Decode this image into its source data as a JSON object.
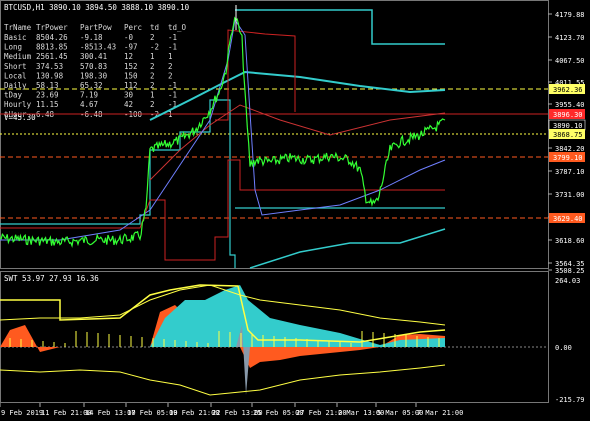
{
  "symbol_line": "BTCUSD,H1  3890.10 3894.50 3888.10 3890.10",
  "stats_table": {
    "headers": [
      "TrName",
      "TrPower",
      "PartPow",
      "Perc",
      "td",
      "td_O"
    ],
    "rows": [
      [
        "Basic",
        "8504.26",
        "-9.18",
        "-0",
        "2",
        "-1"
      ],
      [
        "Long",
        "8813.85",
        "-8513.43",
        "-97",
        "-2",
        "-1"
      ],
      [
        "Medium",
        "2561.45",
        "300.41",
        "12",
        "1",
        "1"
      ],
      [
        "Short",
        "374.53",
        "570.83",
        "152",
        "2",
        "2"
      ],
      [
        "Local",
        "130.98",
        "198.30",
        "150",
        "2",
        "2"
      ],
      [
        "Daily",
        "58.13",
        "65.32",
        "112",
        "2",
        "-1"
      ],
      [
        "tDay",
        "23.69",
        "7.19",
        "30",
        "1",
        "-1"
      ],
      [
        "Hourly",
        "11.15",
        "4.67",
        "42",
        "2",
        "-1"
      ],
      [
        "tHour",
        "6.48",
        "-6.48",
        "-100",
        "-2",
        "1"
      ]
    ]
  },
  "v_label": "V=45.30",
  "price_axis": [
    "4179.88",
    "4123.70",
    "4067.50",
    "4011.55",
    "3955.40",
    "3842.20",
    "3787.10",
    "3731.00",
    "3674.90",
    "3618.60",
    "3564.35",
    "3508.25"
  ],
  "price_badges": [
    {
      "text": "3962.36",
      "color": "#ffff66",
      "text_color": "#000000"
    },
    {
      "text": "3896.30",
      "color": "#ff2a2a",
      "text_color": "#ffffff"
    },
    {
      "text": "3890.10",
      "color": "#000000",
      "text_color": "#ffffff"
    },
    {
      "text": "3868.75",
      "color": "#ffff66",
      "text_color": "#000000"
    },
    {
      "text": "3799.10",
      "color": "#ff5a1f",
      "text_color": "#ffffff"
    },
    {
      "text": "3629.40",
      "color": "#ff5a1f",
      "text_color": "#ffffff"
    }
  ],
  "indicator_line": "SWT 53.97 27.93 16.36",
  "indicator_axis": [
    "264.03",
    "0.00",
    "-215.79"
  ],
  "time_axis": [
    "9 Feb 2019",
    "11 Feb 21:00",
    "14 Feb 13:00",
    "17 Feb 05:00",
    "19 Feb 21:00",
    "22 Feb 13:00",
    "25 Feb 05:00",
    "27 Feb 21:00",
    "2 Mar 13:00",
    "5 Mar 05:00",
    "7 Mar 21:00"
  ],
  "colors": {
    "price": "#33ff33",
    "cyan": "#33cccc",
    "red": "#cc2222",
    "yellow": "#ffff44",
    "orange": "#ff5a1f",
    "teal_fill": "#33cccc"
  }
}
